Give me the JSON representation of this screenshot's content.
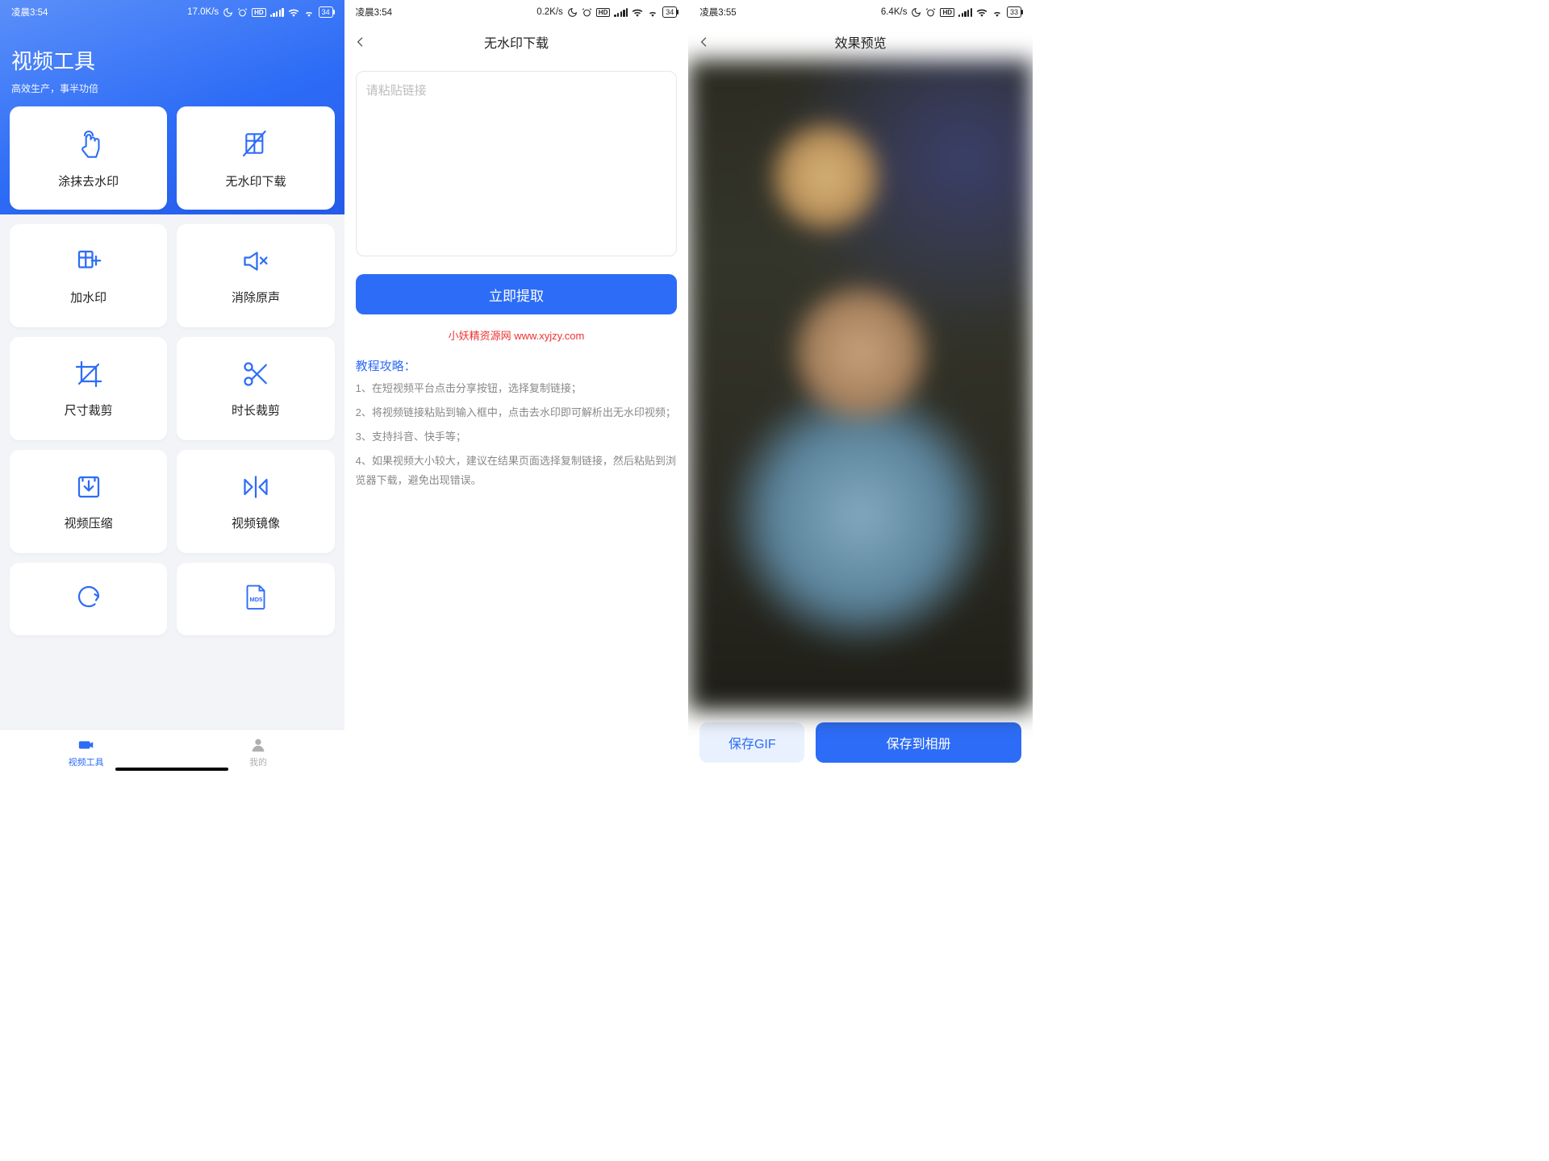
{
  "screen1": {
    "status": {
      "time": "凌晨3:54",
      "speed": "17.0K/s",
      "battery": "34"
    },
    "title": "视频工具",
    "subtitle": "高效生产，事半功倍",
    "tools": [
      {
        "id": "smear-remove-watermark",
        "label": "涂抹去水印"
      },
      {
        "id": "no-watermark-download",
        "label": "无水印下载"
      },
      {
        "id": "add-watermark",
        "label": "加水印"
      },
      {
        "id": "mute-audio",
        "label": "消除原声"
      },
      {
        "id": "crop-size",
        "label": "尺寸裁剪"
      },
      {
        "id": "trim-duration",
        "label": "时长裁剪"
      },
      {
        "id": "video-compress",
        "label": "视频压缩"
      },
      {
        "id": "video-mirror",
        "label": "视频镜像"
      },
      {
        "id": "gif-convert",
        "label": ""
      },
      {
        "id": "md5",
        "label": ""
      }
    ],
    "nav": {
      "tools": "视频工具",
      "mine": "我的"
    }
  },
  "screen2": {
    "status": {
      "time": "凌晨3:54",
      "speed": "0.2K/s",
      "battery": "34"
    },
    "header": "无水印下载",
    "placeholder": "请粘贴链接",
    "action": "立即提取",
    "watermark": "小妖精资源网 www.xyjzy.com",
    "guide_title": "教程攻略：",
    "guide": [
      "1、在短视频平台点击分享按钮，选择复制链接；",
      "2、将视频链接粘贴到输入框中，点击去水印即可解析出无水印视频；",
      "3、支持抖音、快手等；",
      "4、如果视频大小较大，建议在结果页面选择复制链接，然后粘贴到浏览器下载，避免出现错误。"
    ]
  },
  "screen3": {
    "status": {
      "time": "凌晨3:55",
      "speed": "6.4K/s",
      "battery": "33"
    },
    "header": "效果预览",
    "btn_gif": "保存GIF",
    "btn_save": "保存到相册"
  }
}
